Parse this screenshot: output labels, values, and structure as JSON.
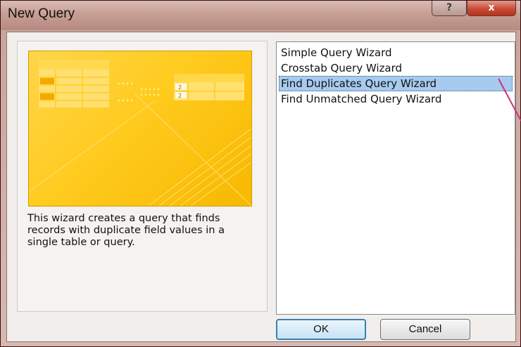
{
  "window": {
    "title": "New Query",
    "help_label": "?",
    "close_label": "x"
  },
  "preview": {
    "description": "This wizard creates a query that finds records with duplicate field values in a single table or query.",
    "table_digit": "2"
  },
  "wizards": {
    "items": [
      {
        "label": "Simple Query Wizard",
        "selected": false
      },
      {
        "label": "Crosstab Query Wizard",
        "selected": false
      },
      {
        "label": "Find Duplicates Query Wizard",
        "selected": true
      },
      {
        "label": "Find Unmatched Query Wizard",
        "selected": false
      }
    ]
  },
  "buttons": {
    "ok_label": "OK",
    "cancel_label": "Cancel"
  },
  "colors": {
    "selection": "#a6cbef",
    "preview_yellow": "#ffcb1f",
    "annotation_line": "#d0307a"
  }
}
